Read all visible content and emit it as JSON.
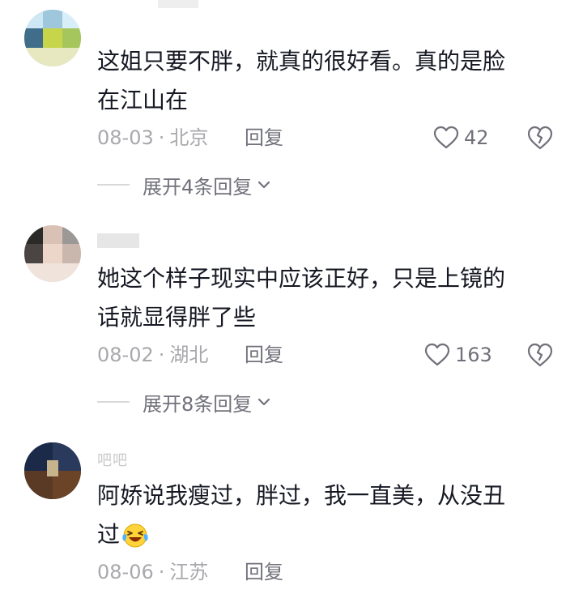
{
  "comments": [
    {
      "text_line1": "这姐只要不胖，就真的很好看。真的是脸",
      "text_line2": "在江山在",
      "date": "08-03",
      "separator": "·",
      "location": "北京",
      "reply_label": "回复",
      "likes": "42",
      "expand_label": "展开4条回复"
    },
    {
      "text_line1": "她这个样子现实中应该正好，只是上镜的",
      "text_line2": "话就显得胖了些",
      "date": "08-02",
      "separator": "·",
      "location": "湖北",
      "reply_label": "回复",
      "likes": "163",
      "expand_label": "展开8条回复"
    },
    {
      "username": "吧吧",
      "text_line1": "阿娇说我瘦过，胖过，我一直美，从没丑",
      "text_line2": "过",
      "emoji": "laughing-crying-emoji",
      "date": "08-06",
      "separator": "·",
      "location": "江苏",
      "reply_label": "回复"
    }
  ],
  "colors": {
    "text": "#161823",
    "meta": "#a8a9ad",
    "secondary": "#70717a",
    "background": "#ffffff"
  }
}
